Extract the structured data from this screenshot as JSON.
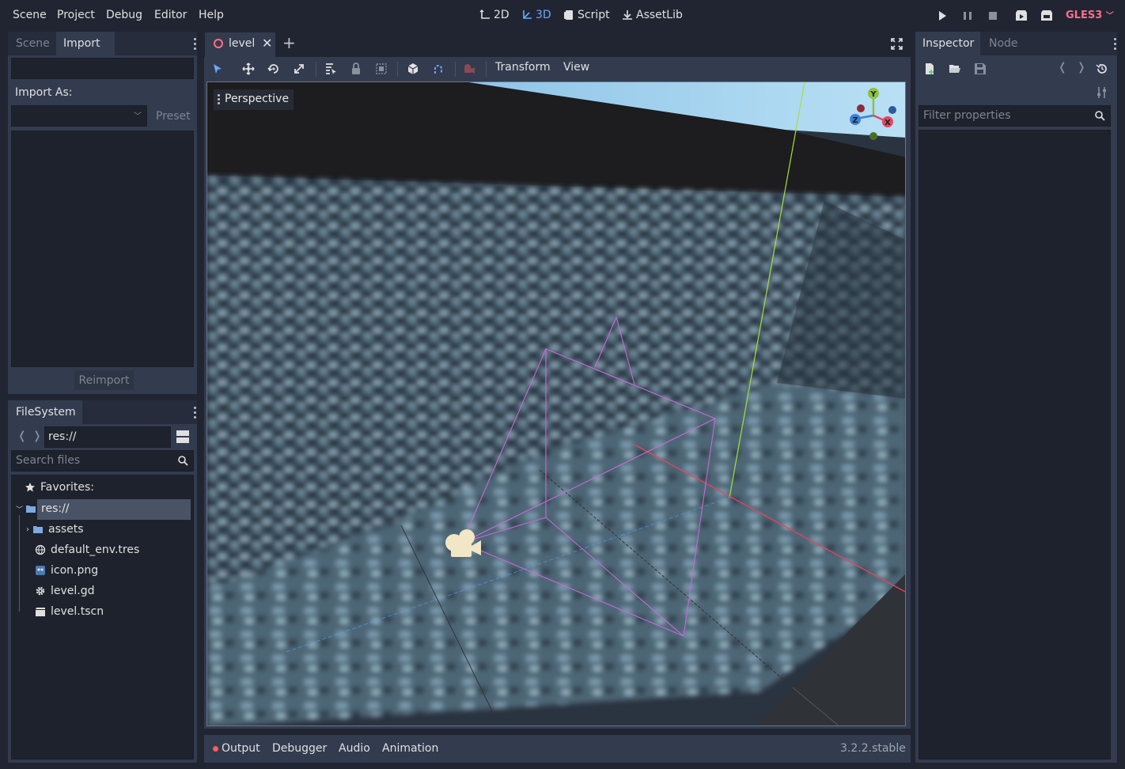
{
  "menu": [
    "Scene",
    "Project",
    "Debug",
    "Editor",
    "Help"
  ],
  "workspaces": [
    "2D",
    "3D",
    "Script",
    "AssetLib"
  ],
  "renderer": "GLES3",
  "left_top": {
    "tabs": [
      "Scene",
      "Import"
    ],
    "import_as_label": "Import As:",
    "preset_label": "Preset",
    "reimport_label": "Reimport"
  },
  "filesystem": {
    "tab": "FileSystem",
    "path": "res://",
    "search_placeholder": "Search files",
    "favorites": "Favorites:",
    "root": "res://",
    "items": [
      "assets",
      "default_env.tres",
      "icon.png",
      "level.gd",
      "level.tscn"
    ]
  },
  "editor": {
    "scene_tab": "level",
    "toolbar_menus": [
      "Transform",
      "View"
    ],
    "perspective_label": "Perspective",
    "gizmo_labels": {
      "y": "Y",
      "x": "X",
      "z": "Z"
    }
  },
  "inspector": {
    "tabs": [
      "Inspector",
      "Node"
    ],
    "filter_placeholder": "Filter properties"
  },
  "bottom": {
    "tabs": [
      "Output",
      "Debugger",
      "Audio",
      "Animation"
    ],
    "version": "3.2.2.stable"
  },
  "colors": {
    "accent": "#6ba8ff",
    "renderer": "#ff6f8a",
    "output_dot": "#ff5d5d"
  }
}
